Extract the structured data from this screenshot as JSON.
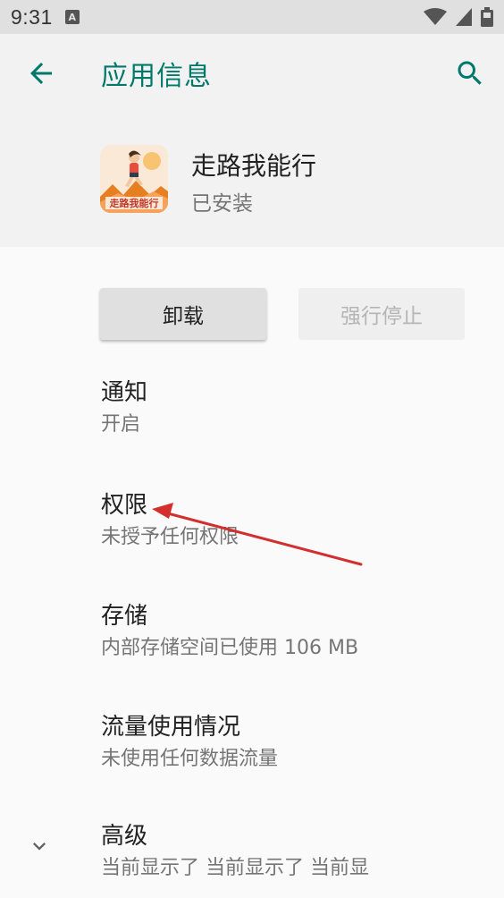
{
  "status_bar": {
    "time": "9:31",
    "notif_letter": "A",
    "icons": [
      "wifi-icon",
      "signal-icon",
      "battery-icon"
    ]
  },
  "header": {
    "title": "应用信息",
    "back_icon": "arrow-left-icon",
    "search_icon": "search-icon"
  },
  "app": {
    "name": "走路我能行",
    "status": "已安装",
    "icon_text": "走路我能行"
  },
  "buttons": {
    "uninstall": "卸载",
    "force_stop": "强行停止"
  },
  "items": [
    {
      "title": "通知",
      "subtitle": "开启"
    },
    {
      "title": "权限",
      "subtitle": "未授予任何权限"
    },
    {
      "title": "存储",
      "subtitle": "内部存储空间已使用 106 MB"
    },
    {
      "title": "流量使用情况",
      "subtitle": "未使用任何数据流量"
    },
    {
      "title": "高级",
      "subtitle": "当前显示了 当前显示了 当前显"
    }
  ],
  "colors": {
    "accent": "#00796b",
    "annotation_arrow": "#d32f2f"
  }
}
